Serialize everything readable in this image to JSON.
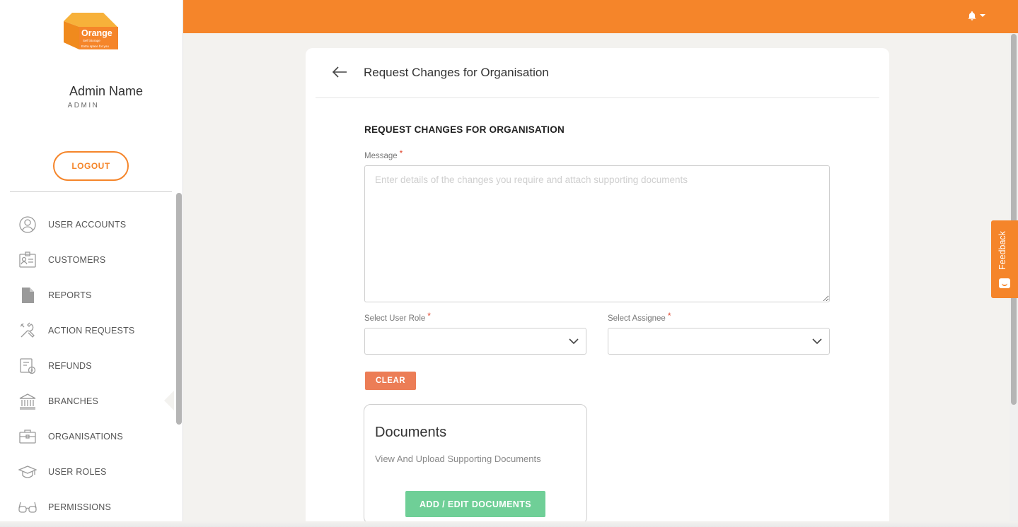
{
  "brand": {
    "logo_name": "Orange",
    "logo_sub": "Self Storage",
    "logo_tagline": "Extra space for you",
    "accent": "#f5852a"
  },
  "profile": {
    "name": "Admin Name",
    "role": "ADMIN",
    "logout_label": "LOGOUT"
  },
  "sidebar": {
    "items": [
      {
        "label": "USER ACCOUNTS",
        "icon": "user-circle-icon"
      },
      {
        "label": "CUSTOMERS",
        "icon": "id-card-icon"
      },
      {
        "label": "REPORTS",
        "icon": "document-icon"
      },
      {
        "label": "ACTION REQUESTS",
        "icon": "tools-icon"
      },
      {
        "label": "REFUNDS",
        "icon": "refund-receipt-icon"
      },
      {
        "label": "BRANCHES",
        "icon": "bank-building-icon"
      },
      {
        "label": "ORGANISATIONS",
        "icon": "briefcase-icon"
      },
      {
        "label": "USER ROLES",
        "icon": "graduation-cap-icon"
      },
      {
        "label": "PERMISSIONS",
        "icon": "glasses-icon"
      }
    ]
  },
  "topbar": {
    "notification_icon": "bell-icon"
  },
  "page": {
    "title": "Request Changes for Organisation",
    "form_heading": "REQUEST CHANGES FOR ORGANISATION",
    "message_label": "Message",
    "message_placeholder": "Enter details of the changes you require and attach supporting documents",
    "required_mark": "*",
    "user_role_label": "Select User Role",
    "user_role_value": "",
    "assignee_label": "Select Assignee",
    "assignee_value": "",
    "clear_label": "CLEAR"
  },
  "documents": {
    "title": "Documents",
    "subtitle": "View And Upload Supporting Documents",
    "button_label": "ADD / EDIT DOCUMENTS"
  },
  "feedback": {
    "label": "Feedback"
  }
}
